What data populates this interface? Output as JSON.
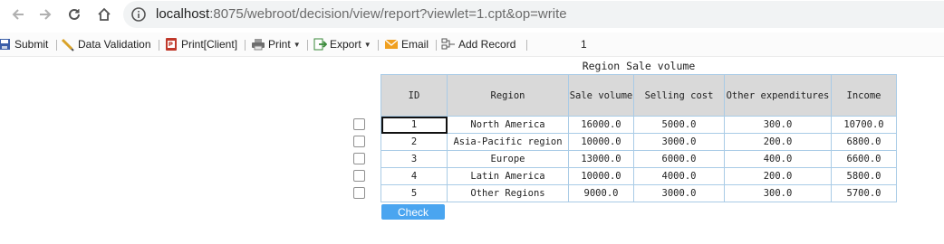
{
  "browser": {
    "url_host": "localhost",
    "url_path": ":8075/webroot/decision/view/report?viewlet=1.cpt&op=write"
  },
  "toolbar": {
    "submit": "Submit",
    "data_validation": "Data Validation",
    "print_client": "Print[Client]",
    "print": "Print",
    "export": "Export",
    "email": "Email",
    "add_record": "Add Record",
    "page_number": "1"
  },
  "report": {
    "title": "Region Sale volume",
    "columns": [
      "ID",
      "Region",
      "Sale volume",
      "Selling cost",
      "Other expenditures",
      "Income"
    ],
    "rows": [
      [
        "1",
        "North America",
        "16000.0",
        "5000.0",
        "300.0",
        "10700.0"
      ],
      [
        "2",
        "Asia-Pacific region",
        "10000.0",
        "3000.0",
        "200.0",
        "6800.0"
      ],
      [
        "3",
        "Europe",
        "13000.0",
        "6000.0",
        "400.0",
        "6600.0"
      ],
      [
        "4",
        "Latin America",
        "10000.0",
        "4000.0",
        "200.0",
        "5800.0"
      ],
      [
        "5",
        "Other Regions",
        "9000.0",
        "3000.0",
        "300.0",
        "5700.0"
      ]
    ],
    "check_button": "Check"
  }
}
